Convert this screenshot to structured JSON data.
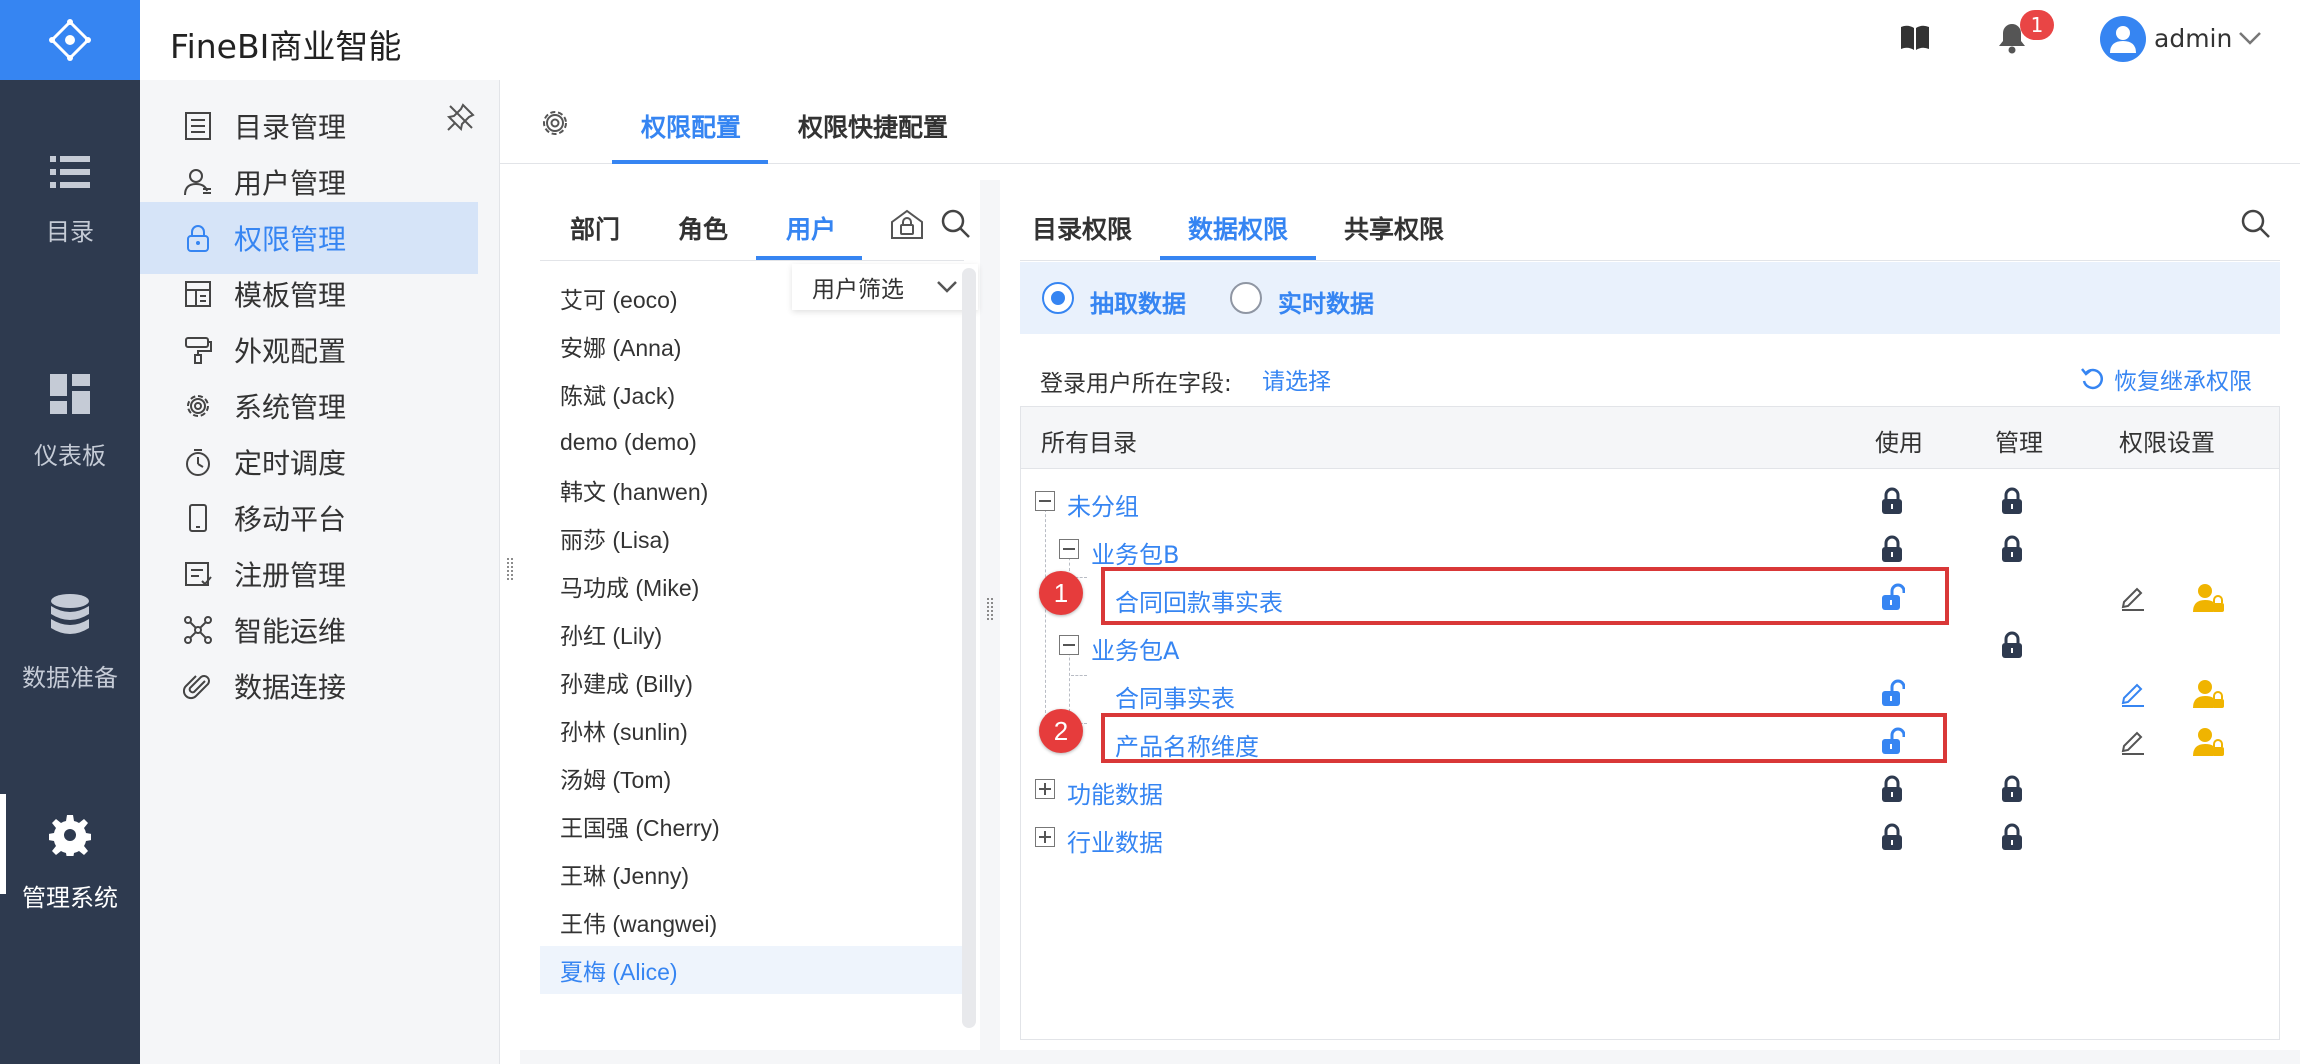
{
  "app": {
    "title": "FineBI商业智能"
  },
  "header": {
    "notification_count": "1",
    "user_name": "admin"
  },
  "rail": {
    "items": [
      {
        "label": "目录",
        "icon": "list-icon"
      },
      {
        "label": "仪表板",
        "icon": "dashboard-icon"
      },
      {
        "label": "数据准备",
        "icon": "database-icon"
      },
      {
        "label": "管理系统",
        "icon": "gear-icon",
        "active": true
      }
    ]
  },
  "sidemenu": {
    "items": [
      {
        "label": "目录管理",
        "icon": "catalog-icon"
      },
      {
        "label": "用户管理",
        "icon": "user-icon"
      },
      {
        "label": "权限管理",
        "icon": "lock-icon",
        "active": true
      },
      {
        "label": "模板管理",
        "icon": "template-icon"
      },
      {
        "label": "外观配置",
        "icon": "paint-roller-icon"
      },
      {
        "label": "系统管理",
        "icon": "gear-icon"
      },
      {
        "label": "定时调度",
        "icon": "timer-icon"
      },
      {
        "label": "移动平台",
        "icon": "mobile-icon"
      },
      {
        "label": "注册管理",
        "icon": "register-icon"
      },
      {
        "label": "智能运维",
        "icon": "network-icon"
      },
      {
        "label": "数据连接",
        "icon": "paperclip-icon"
      }
    ]
  },
  "top_tabs": [
    {
      "label": "权限配置",
      "active": true
    },
    {
      "label": "权限快捷配置"
    }
  ],
  "user_panel": {
    "tabs": [
      {
        "label": "部门"
      },
      {
        "label": "角色"
      },
      {
        "label": "用户",
        "active": true
      }
    ],
    "filter_label": "用户筛选",
    "users": [
      "艾可 (eoco)",
      "安娜 (Anna)",
      "陈斌 (Jack)",
      "demo (demo)",
      "韩文 (hanwen)",
      "丽莎 (Lisa)",
      "马功成 (Mike)",
      "孙红 (Lily)",
      "孙建成 (Billy)",
      "孙林 (sunlin)",
      "汤姆 (Tom)",
      "王国强 (Cherry)",
      "王琳 (Jenny)",
      "王伟 (wangwei)",
      "夏梅 (Alice)"
    ],
    "selected_user": "夏梅 (Alice)"
  },
  "perm_panel": {
    "tabs": [
      {
        "label": "目录权限"
      },
      {
        "label": "数据权限",
        "active": true
      },
      {
        "label": "共享权限"
      }
    ],
    "modes": [
      {
        "label": "抽取数据",
        "selected": true
      },
      {
        "label": "实时数据",
        "selected": false
      }
    ],
    "field_label": "登录用户所在字段:",
    "field_select": "请选择",
    "restore_label": "恢复继承权限",
    "columns": {
      "all": "所有目录",
      "use": "使用",
      "manage": "管理",
      "settings": "权限设置"
    },
    "tree": [
      {
        "name": "未分组",
        "level": 0,
        "toggle": "minus",
        "use": "locked",
        "manage": "locked"
      },
      {
        "name": "业务包B",
        "level": 1,
        "toggle": "minus",
        "use": "locked",
        "manage": "locked"
      },
      {
        "name": "合同回款事实表",
        "level": 2,
        "use": "unlocked",
        "settings": true,
        "edit_color": "#555555"
      },
      {
        "name": "业务包A",
        "level": 1,
        "toggle": "minus",
        "manage": "locked"
      },
      {
        "name": "合同事实表",
        "level": 2,
        "use": "unlocked",
        "settings": true,
        "edit_color": "#3685f2"
      },
      {
        "name": "产品名称维度",
        "level": 2,
        "use": "unlocked",
        "settings": true,
        "edit_color": "#555555"
      },
      {
        "name": "功能数据",
        "level": 0,
        "toggle": "plus",
        "use": "locked",
        "manage": "locked"
      },
      {
        "name": "行业数据",
        "level": 0,
        "toggle": "plus",
        "use": "locked",
        "manage": "locked"
      }
    ]
  },
  "callouts": [
    "1",
    "2"
  ],
  "colors": {
    "accent": "#3685f2",
    "rail": "#2e3a4f",
    "highlight": "#d93838",
    "user_lock": "#f0b400"
  }
}
